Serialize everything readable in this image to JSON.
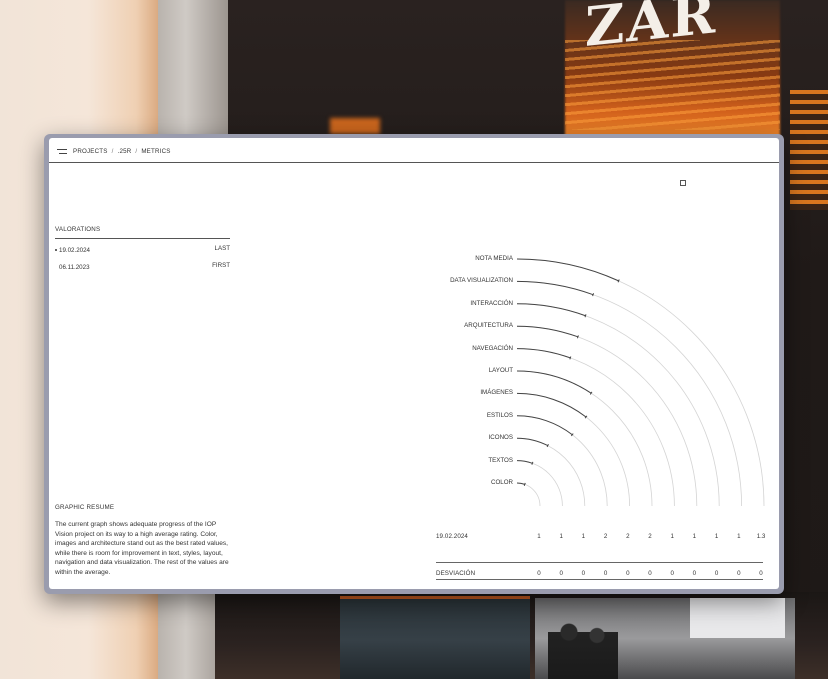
{
  "breadcrumb": {
    "items": [
      "PROJECTS",
      ".25R",
      "METRICS"
    ],
    "separator": "/"
  },
  "valorations": {
    "title": "VALORATIONS",
    "rows": [
      {
        "date": "19.02.2024",
        "tag": "LAST",
        "selected": true
      },
      {
        "date": "06.11.2023",
        "tag": "FIRST",
        "selected": false
      }
    ]
  },
  "graphic_resume": {
    "title": "GRAPHIC RESUME",
    "text": "The current graph shows adequate progress of the IOP Vision project on its way to a high average rating. Color, images and architecture stand out as the best rated values, while there is room for improvement in text, styles, layout, navigation and data visualization. The rest of the values are within the average."
  },
  "table": {
    "row1_label": "19.02.2024",
    "row2_label": "DESVIACIÓN"
  },
  "colors": {
    "background_panel": "#ffffff",
    "window_frame": "#9a9cae",
    "ink": "#333333",
    "arc_track": "#d4d4d4",
    "arc_value": "#444444"
  },
  "icons": {
    "menu": "hamburger-icon",
    "corner": "square-icon"
  },
  "chart_data": {
    "type": "radial-bar",
    "categories": [
      "NOTA MEDIA",
      "DATA VISUALIZATION",
      "INTERACCIÓN",
      "ARQUITECTURA",
      "NAVEGACIÓN",
      "LAYOUT",
      "IMÁGENES",
      "ESTILOS",
      "ICONOS",
      "TEXTOS",
      "COLOR"
    ],
    "value_fraction_of_track": [
      0.27,
      0.22,
      0.22,
      0.22,
      0.22,
      0.37,
      0.42,
      0.42,
      0.3,
      0.22,
      0.22
    ],
    "columns": [
      {
        "value": "1",
        "deviation": "0"
      },
      {
        "value": "1",
        "deviation": "0"
      },
      {
        "value": "1",
        "deviation": "0"
      },
      {
        "value": "2",
        "deviation": "0"
      },
      {
        "value": "2",
        "deviation": "0"
      },
      {
        "value": "2",
        "deviation": "0"
      },
      {
        "value": "1",
        "deviation": "0"
      },
      {
        "value": "1",
        "deviation": "0"
      },
      {
        "value": "1",
        "deviation": "0"
      },
      {
        "value": "1",
        "deviation": "0"
      },
      {
        "value": "1.3",
        "deviation": "0"
      }
    ],
    "grid": false
  }
}
